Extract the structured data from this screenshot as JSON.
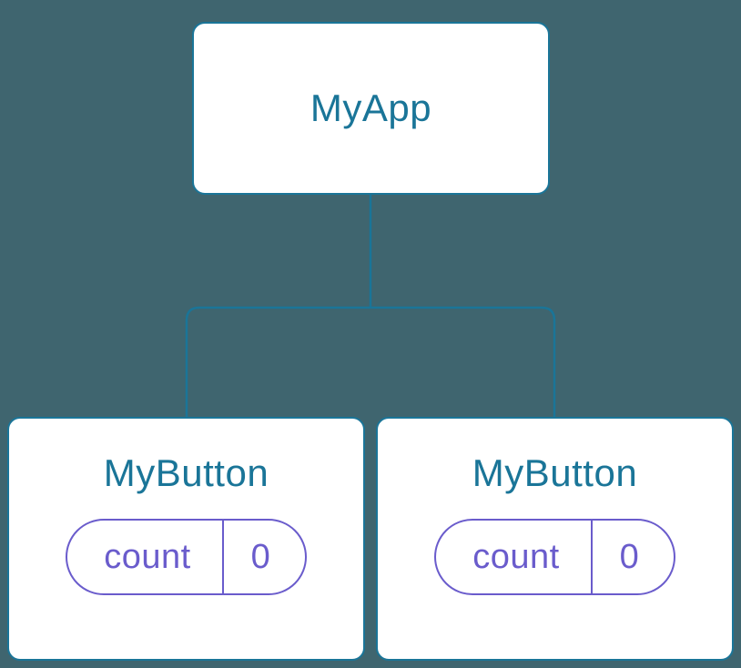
{
  "root": {
    "label": "MyApp"
  },
  "children": [
    {
      "label": "MyButton",
      "state": {
        "key": "count",
        "value": "0"
      }
    },
    {
      "label": "MyButton",
      "state": {
        "key": "count",
        "value": "0"
      }
    }
  ],
  "colors": {
    "nodeBorder": "#1a7598",
    "nodeText": "#1a7598",
    "pillBorder": "#6a5ccc",
    "pillText": "#6a5ccc",
    "background": "#3f656f",
    "nodeBackground": "#ffffff"
  }
}
